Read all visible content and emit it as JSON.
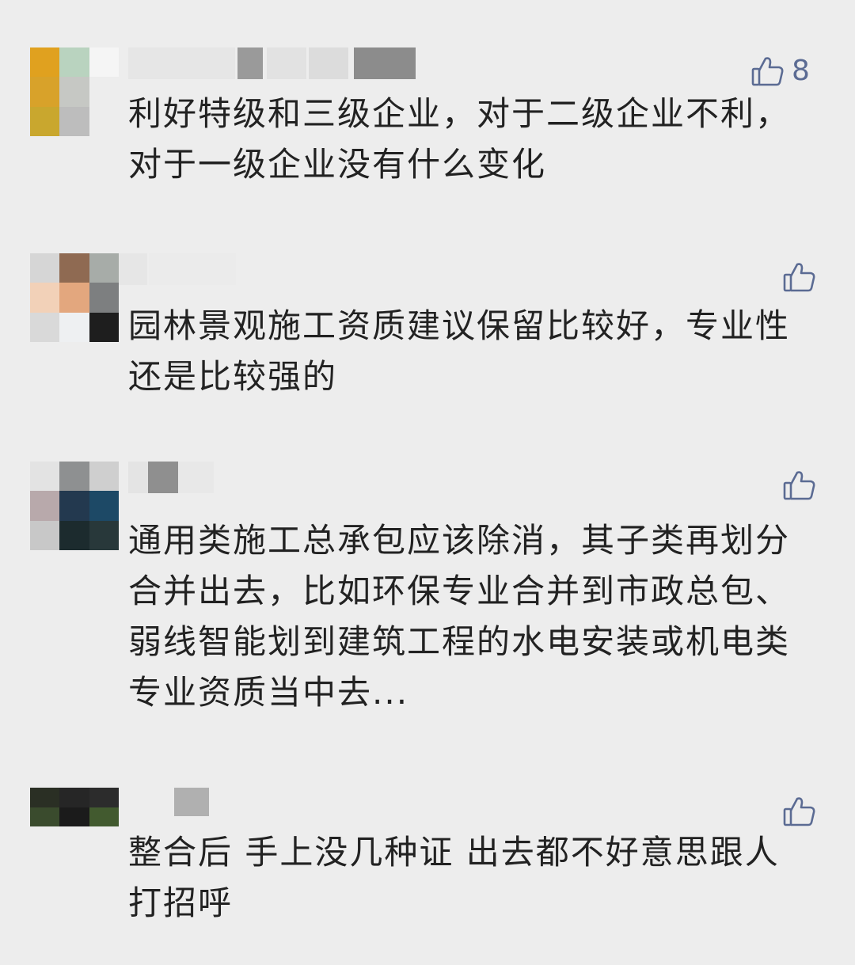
{
  "comments": [
    {
      "text": "利好特级和三级企业，对于二级企业不利，对于一级企业没有什么变化",
      "likes": "8"
    },
    {
      "text": "园林景观施工资质建议保留比较好，专业性还是比较强的",
      "likes": ""
    },
    {
      "text": "通用类施工总承包应该除消，其子类再划分合并出去，比如环保专业合并到市政总包、弱线智能划到建筑工程的水电安装或机电类专业资质当中去...",
      "likes": ""
    },
    {
      "text": "整合后 手上没几种证 出去都不好意思跟人打招呼",
      "likes": ""
    }
  ],
  "icons": {
    "like": "thumbs-up-icon"
  },
  "colors": {
    "background": "#ededed",
    "text": "#222222",
    "like_icon": "#5b6b93"
  }
}
